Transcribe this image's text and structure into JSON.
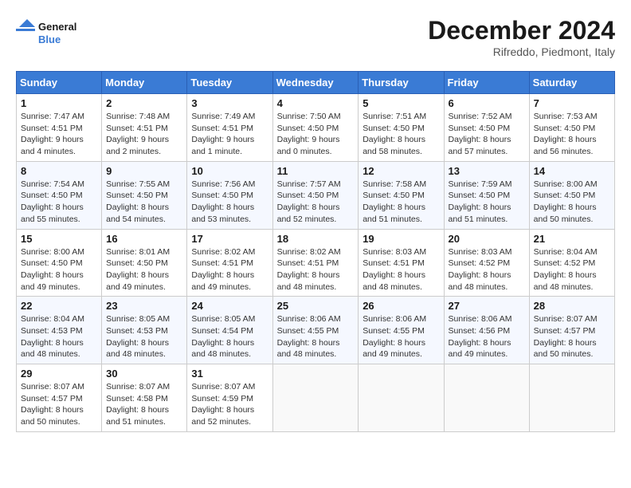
{
  "header": {
    "logo_line1": "General",
    "logo_line2": "Blue",
    "month": "December 2024",
    "location": "Rifreddo, Piedmont, Italy"
  },
  "weekdays": [
    "Sunday",
    "Monday",
    "Tuesday",
    "Wednesday",
    "Thursday",
    "Friday",
    "Saturday"
  ],
  "weeks": [
    [
      {
        "day": "1",
        "info": "Sunrise: 7:47 AM\nSunset: 4:51 PM\nDaylight: 9 hours\nand 4 minutes."
      },
      {
        "day": "2",
        "info": "Sunrise: 7:48 AM\nSunset: 4:51 PM\nDaylight: 9 hours\nand 2 minutes."
      },
      {
        "day": "3",
        "info": "Sunrise: 7:49 AM\nSunset: 4:51 PM\nDaylight: 9 hours\nand 1 minute."
      },
      {
        "day": "4",
        "info": "Sunrise: 7:50 AM\nSunset: 4:50 PM\nDaylight: 9 hours\nand 0 minutes."
      },
      {
        "day": "5",
        "info": "Sunrise: 7:51 AM\nSunset: 4:50 PM\nDaylight: 8 hours\nand 58 minutes."
      },
      {
        "day": "6",
        "info": "Sunrise: 7:52 AM\nSunset: 4:50 PM\nDaylight: 8 hours\nand 57 minutes."
      },
      {
        "day": "7",
        "info": "Sunrise: 7:53 AM\nSunset: 4:50 PM\nDaylight: 8 hours\nand 56 minutes."
      }
    ],
    [
      {
        "day": "8",
        "info": "Sunrise: 7:54 AM\nSunset: 4:50 PM\nDaylight: 8 hours\nand 55 minutes."
      },
      {
        "day": "9",
        "info": "Sunrise: 7:55 AM\nSunset: 4:50 PM\nDaylight: 8 hours\nand 54 minutes."
      },
      {
        "day": "10",
        "info": "Sunrise: 7:56 AM\nSunset: 4:50 PM\nDaylight: 8 hours\nand 53 minutes."
      },
      {
        "day": "11",
        "info": "Sunrise: 7:57 AM\nSunset: 4:50 PM\nDaylight: 8 hours\nand 52 minutes."
      },
      {
        "day": "12",
        "info": "Sunrise: 7:58 AM\nSunset: 4:50 PM\nDaylight: 8 hours\nand 51 minutes."
      },
      {
        "day": "13",
        "info": "Sunrise: 7:59 AM\nSunset: 4:50 PM\nDaylight: 8 hours\nand 51 minutes."
      },
      {
        "day": "14",
        "info": "Sunrise: 8:00 AM\nSunset: 4:50 PM\nDaylight: 8 hours\nand 50 minutes."
      }
    ],
    [
      {
        "day": "15",
        "info": "Sunrise: 8:00 AM\nSunset: 4:50 PM\nDaylight: 8 hours\nand 49 minutes."
      },
      {
        "day": "16",
        "info": "Sunrise: 8:01 AM\nSunset: 4:50 PM\nDaylight: 8 hours\nand 49 minutes."
      },
      {
        "day": "17",
        "info": "Sunrise: 8:02 AM\nSunset: 4:51 PM\nDaylight: 8 hours\nand 49 minutes."
      },
      {
        "day": "18",
        "info": "Sunrise: 8:02 AM\nSunset: 4:51 PM\nDaylight: 8 hours\nand 48 minutes."
      },
      {
        "day": "19",
        "info": "Sunrise: 8:03 AM\nSunset: 4:51 PM\nDaylight: 8 hours\nand 48 minutes."
      },
      {
        "day": "20",
        "info": "Sunrise: 8:03 AM\nSunset: 4:52 PM\nDaylight: 8 hours\nand 48 minutes."
      },
      {
        "day": "21",
        "info": "Sunrise: 8:04 AM\nSunset: 4:52 PM\nDaylight: 8 hours\nand 48 minutes."
      }
    ],
    [
      {
        "day": "22",
        "info": "Sunrise: 8:04 AM\nSunset: 4:53 PM\nDaylight: 8 hours\nand 48 minutes."
      },
      {
        "day": "23",
        "info": "Sunrise: 8:05 AM\nSunset: 4:53 PM\nDaylight: 8 hours\nand 48 minutes."
      },
      {
        "day": "24",
        "info": "Sunrise: 8:05 AM\nSunset: 4:54 PM\nDaylight: 8 hours\nand 48 minutes."
      },
      {
        "day": "25",
        "info": "Sunrise: 8:06 AM\nSunset: 4:55 PM\nDaylight: 8 hours\nand 48 minutes."
      },
      {
        "day": "26",
        "info": "Sunrise: 8:06 AM\nSunset: 4:55 PM\nDaylight: 8 hours\nand 49 minutes."
      },
      {
        "day": "27",
        "info": "Sunrise: 8:06 AM\nSunset: 4:56 PM\nDaylight: 8 hours\nand 49 minutes."
      },
      {
        "day": "28",
        "info": "Sunrise: 8:07 AM\nSunset: 4:57 PM\nDaylight: 8 hours\nand 50 minutes."
      }
    ],
    [
      {
        "day": "29",
        "info": "Sunrise: 8:07 AM\nSunset: 4:57 PM\nDaylight: 8 hours\nand 50 minutes."
      },
      {
        "day": "30",
        "info": "Sunrise: 8:07 AM\nSunset: 4:58 PM\nDaylight: 8 hours\nand 51 minutes."
      },
      {
        "day": "31",
        "info": "Sunrise: 8:07 AM\nSunset: 4:59 PM\nDaylight: 8 hours\nand 52 minutes."
      },
      {
        "day": "",
        "info": ""
      },
      {
        "day": "",
        "info": ""
      },
      {
        "day": "",
        "info": ""
      },
      {
        "day": "",
        "info": ""
      }
    ]
  ]
}
